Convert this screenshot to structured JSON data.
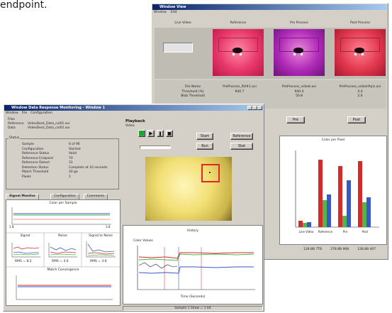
{
  "caption": "endpoint.",
  "back_window": {
    "title": "Window View",
    "menu": [
      "Window",
      "Edit"
    ],
    "columns": [
      "Live Video",
      "Reference",
      "Pre Process",
      "Post Process"
    ],
    "file_labels": [
      "File Name",
      "Threshold (%)",
      "Blob Threshold"
    ],
    "file_cols": [
      [
        "PreProcess_RH#1.avi",
        "940.7"
      ],
      [
        "PreProcess_vidset.avi",
        "940.4",
        "50.8"
      ],
      [
        "PreProcess_vidset#pic.avi",
        "4.4",
        "2.6"
      ]
    ],
    "buttons": [
      "Pre",
      "Post"
    ],
    "chart": {
      "title": "Color per Pixel",
      "categories": [
        "Live Video",
        "Reference",
        "Pre",
        "Post"
      ],
      "colors": {
        "red": "#d42a2a",
        "green": "#4fb64a",
        "blue": "#3a58c6"
      }
    },
    "status": [
      "128.8B 7TB",
      "278.8B 968",
      "128.8B 407"
    ]
  },
  "front_window": {
    "title": "Window Data Response Monitoring - Window 1",
    "menu": [
      "Window",
      "File",
      "Configuration"
    ],
    "files": {
      "labels": [
        "Files",
        "Reference",
        "Data"
      ],
      "values": [
        "",
        "VideoDeck_Data_col01.avi",
        "VideoDeck_Data_col02.avi"
      ]
    },
    "status_group": "Status",
    "status_rows": [
      [
        "Sample",
        "6 of 96"
      ],
      [
        "Configuration",
        "Started"
      ],
      [
        "Reference Status",
        "Valid"
      ],
      [
        "Reference Endpoint",
        "70"
      ],
      [
        "Reference Detect",
        "31"
      ],
      [
        "Detection Status",
        "Complete at 10 seconds"
      ],
      [
        "Match Threshold",
        "20 ge"
      ],
      [
        "Pixels",
        "1"
      ]
    ],
    "tabs": [
      "Signal Monitor",
      "Configuration",
      "Comments"
    ],
    "panel": {
      "color_title": "Color per Sample",
      "color_ticks": [
        "1.8",
        "3.8"
      ],
      "small_charts": [
        {
          "title": "Signal",
          "rms": "RMS = 8.2"
        },
        {
          "title": "Noise",
          "rms": "RMS = 4.6"
        },
        {
          "title": "Signal to Noise",
          "rms": "RMS = 3.8"
        }
      ],
      "convergence_title": "Match Convergence"
    },
    "playback": {
      "label": "Playback",
      "sublabel": "Video",
      "buttons": [
        "Start",
        "Run",
        "Reference",
        "Stat"
      ]
    },
    "history": {
      "title": "History",
      "ylabel": "Color Values",
      "xlabel": "Time (Seconds)"
    },
    "status_bar": "Sample 1 Show = 1 64"
  }
}
